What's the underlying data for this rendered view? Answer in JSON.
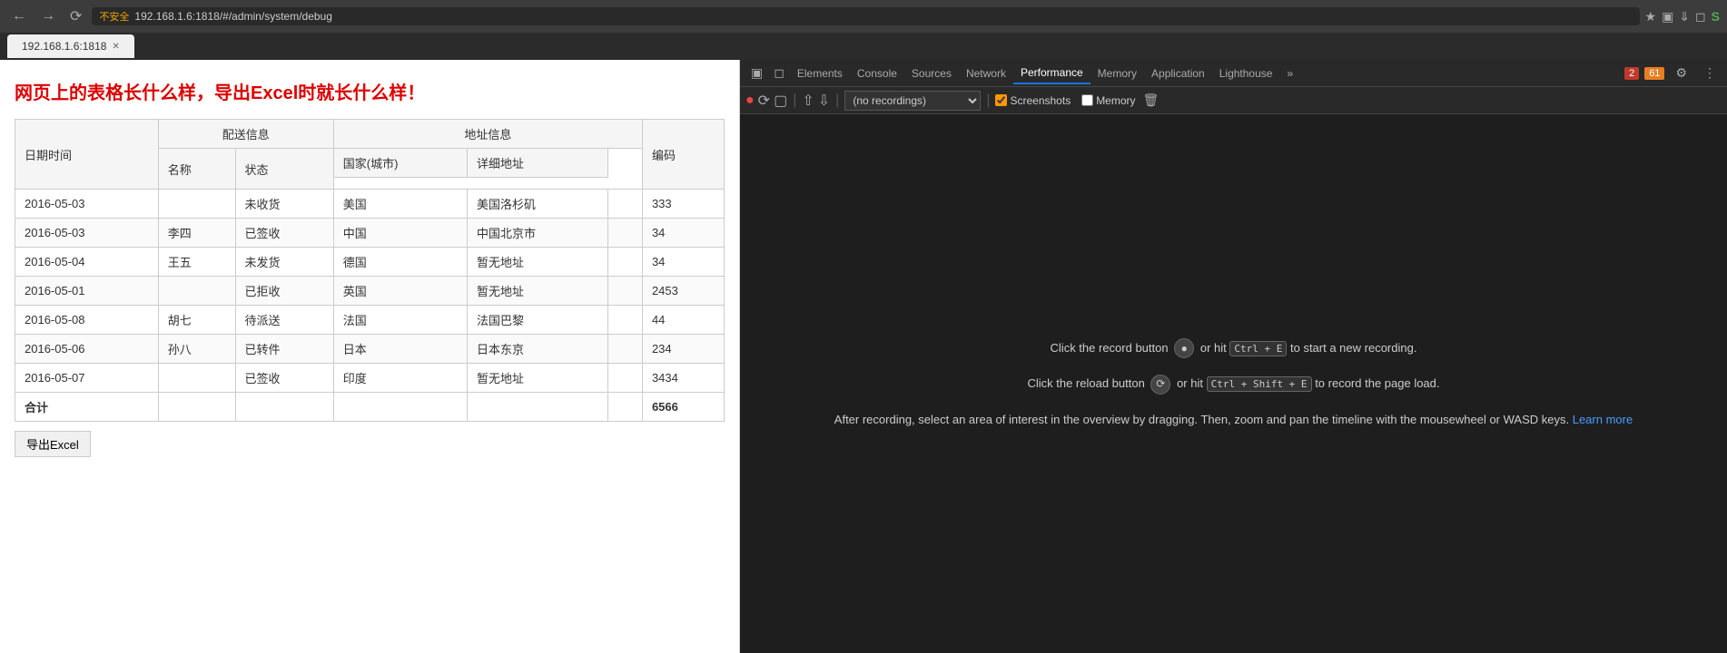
{
  "browser": {
    "url": "192.168.1.6:1818/#/admin/system/debug",
    "url_full": "192.168.1.6:1818/#/admin/system/debug",
    "warning": "不安全",
    "tab_title": "192.168.1.6:1818"
  },
  "page": {
    "title": "网页上的表格长什么样，导出Excel时就长什么样！",
    "export_btn": "导出Excel"
  },
  "table": {
    "headers": {
      "date": "日期时间",
      "delivery": "配送信息",
      "address": "地址信息",
      "name": "名称",
      "status": "状态",
      "country": "国家(城市)",
      "detail": "详细地址",
      "code": "编码"
    },
    "rows": [
      {
        "date": "2016-05-03",
        "name": "",
        "status": "未收货",
        "country": "美国",
        "detail": "美国洛杉矶",
        "code": "333"
      },
      {
        "date": "2016-05-03",
        "name": "李四",
        "status": "已签收",
        "country": "中国",
        "detail": "中国北京市",
        "code": "34"
      },
      {
        "date": "2016-05-04",
        "name": "王五",
        "status": "未发货",
        "country": "德国",
        "detail": "暂无地址",
        "code": "34"
      },
      {
        "date": "2016-05-01",
        "name": "",
        "status": "已拒收",
        "country": "英国",
        "detail": "暂无地址",
        "code": "2453"
      },
      {
        "date": "2016-05-08",
        "name": "胡七",
        "status": "待派送",
        "country": "法国",
        "detail": "法国巴黎",
        "code": "44"
      },
      {
        "date": "2016-05-06",
        "name": "孙八",
        "status": "已转件",
        "country": "日本",
        "detail": "日本东京",
        "code": "234"
      },
      {
        "date": "2016-05-07",
        "name": "",
        "status": "已签收",
        "country": "印度",
        "detail": "暂无地址",
        "code": "3434"
      }
    ],
    "total_label": "合计",
    "total_code": "6566"
  },
  "devtools": {
    "tabs": [
      "Elements",
      "Console",
      "Sources",
      "Network",
      "Performance",
      "Memory",
      "Application",
      "Lighthouse"
    ],
    "active_tab": "Performance",
    "more_tabs": "»",
    "badge_error": "2",
    "badge_warn": "61",
    "no_recordings": "(no recordings)",
    "screenshot_label": "Screenshots",
    "memory_label": "Memory",
    "hint1_pre": "Click the record button",
    "hint1_mid": "or hit",
    "hint1_kbd1": "Ctrl + E",
    "hint1_post": "to start a new recording.",
    "hint2_pre": "Click the reload button",
    "hint2_mid": "or hit",
    "hint2_kbd1": "Ctrl + Shift + E",
    "hint2_post": "to record the page load.",
    "hint3": "After recording, select an area of interest in the overview by dragging. Then, zoom and pan the timeline with the mousewheel or WASD keys.",
    "hint3_link": "Learn more"
  }
}
